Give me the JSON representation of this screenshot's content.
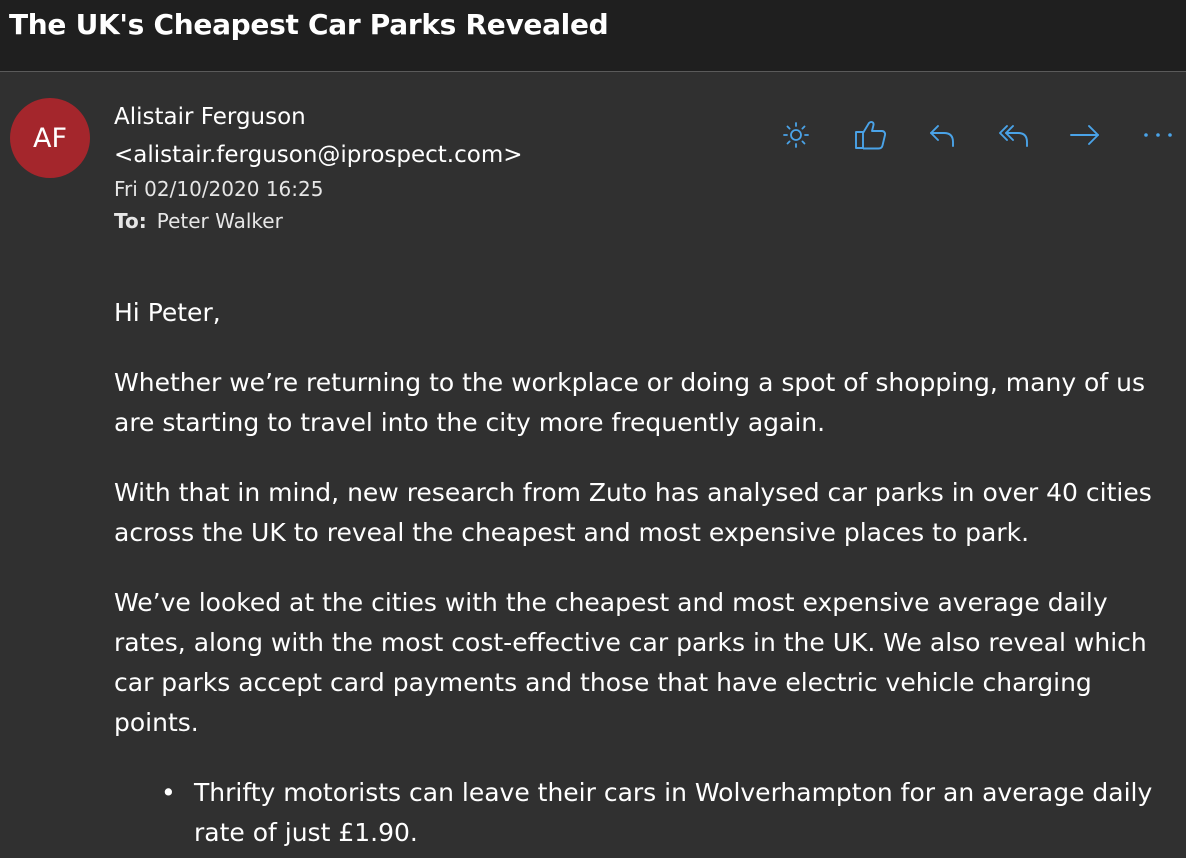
{
  "email": {
    "subject": "The UK's Cheapest Car Parks Revealed",
    "avatar_initials": "AF",
    "avatar_color": "#a4262c",
    "sender": "Alistair Ferguson <alistair.ferguson@iprospect.com>",
    "date": "Fri 02/10/2020 16:25",
    "to_label": "To:",
    "to_value": "Peter Walker"
  },
  "actions": [
    {
      "name": "brightness-icon"
    },
    {
      "name": "like-icon"
    },
    {
      "name": "reply-icon"
    },
    {
      "name": "reply-all-icon"
    },
    {
      "name": "forward-icon"
    },
    {
      "name": "more-icon"
    }
  ],
  "accent_color": "#4aa3e8",
  "body": {
    "greeting": "Hi Peter,",
    "para1": "Whether we’re returning to the workplace or doing a spot of shopping, many of us are starting to travel into the city more frequently again.",
    "para2": "With that in mind, new research from Zuto has analysed car parks in over 40 cities across the UK to reveal the cheapest and most expensive places to park.",
    "para3": "We’ve looked at the cities with the cheapest and most expensive average daily rates, along with the most cost-effective car parks in the UK. We also reveal which car parks accept card payments and those that have electric vehicle charging points.",
    "bullets": [
      "Thrifty motorists can leave their cars in Wolverhampton for an average daily rate of just £1.90."
    ],
    "bullet_glyph": "•"
  }
}
